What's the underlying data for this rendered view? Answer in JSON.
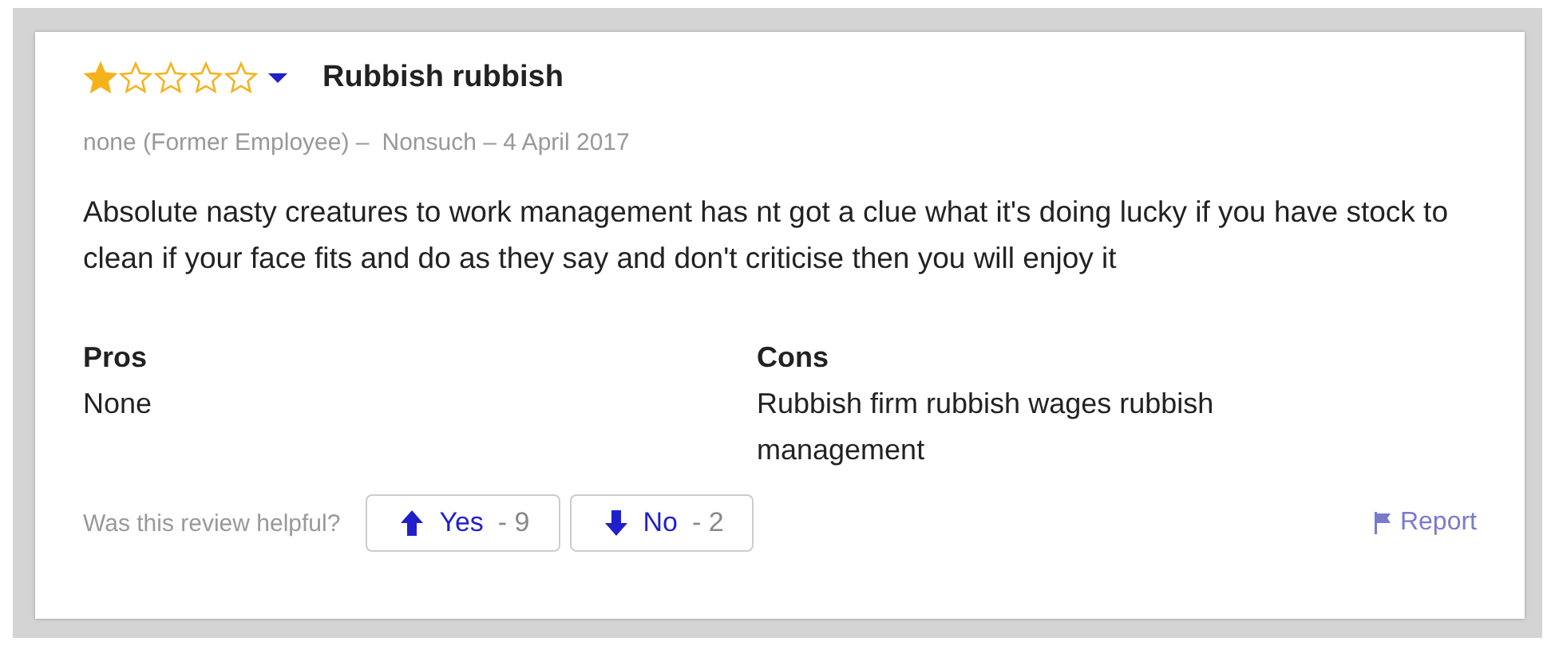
{
  "review": {
    "stars": 1,
    "title": "Rubbish rubbish",
    "meta": [
      {
        "text": "none (Former Employee) –"
      },
      {
        "text": "Nonsuch – 4 April 2017"
      }
    ],
    "body": "Absolute nasty creatures to work management has nt got a clue what it's doing lucky if you have stock to clean if your face fits and do as they say and don't criticise then you will enjoy it",
    "sections": [
      {
        "heading": "Pros",
        "text": "None"
      },
      {
        "heading": "Cons",
        "text": "Rubbish firm rubbish wages rubbish management"
      }
    ],
    "helpful": {
      "question": "Was this review helpful?",
      "votes": [
        {
          "kind": "up",
          "label": "Yes",
          "count": "- 9"
        },
        {
          "kind": "down",
          "label": "No",
          "count": "- 2"
        }
      ],
      "report": "Report"
    }
  }
}
